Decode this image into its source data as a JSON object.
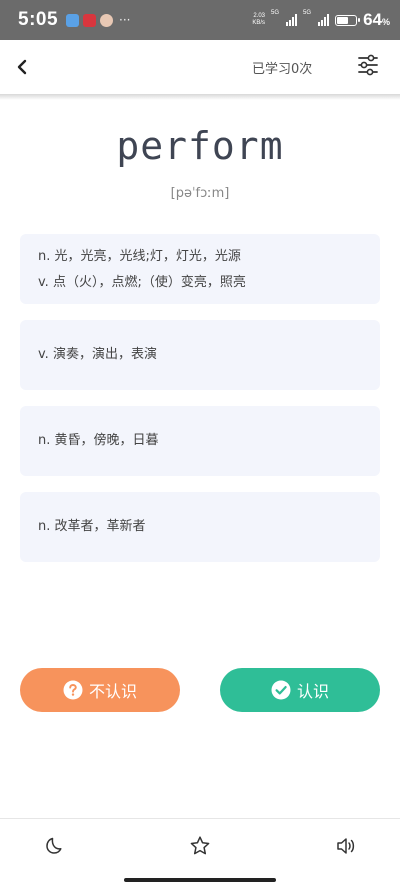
{
  "status_bar": {
    "time": "5:05",
    "net_speed": "2.03\nKB/s",
    "sig1_label": "5G",
    "sig2_label": "5G",
    "battery": "64",
    "battery_unit": "%",
    "battery_level": 0.64,
    "more": "···"
  },
  "header": {
    "back_icon": "chevron-left-icon",
    "learned_count": "已学习0次",
    "settings_icon": "sliders-icon"
  },
  "word": {
    "text": "perform",
    "phonetic": "[pəˈfɔːm]"
  },
  "meanings": [
    {
      "lines": [
        "n. 光，光亮，光线;灯，灯光，光源",
        "v. 点（火），点燃;（使）变亮，照亮"
      ]
    },
    {
      "lines": [
        "v. 演奏，演出，表演"
      ]
    },
    {
      "lines": [
        "n. 黄昏，傍晚，日暮"
      ]
    },
    {
      "lines": [
        "n. 改革者，革新者"
      ]
    }
  ],
  "actions": {
    "unknown_label": "不认识",
    "known_label": "认识",
    "unknown_color": "#f7935c",
    "known_color": "#2fbe97"
  },
  "bottom_bar": {
    "icons": [
      "moon-icon",
      "star-icon",
      "speaker-icon"
    ]
  }
}
